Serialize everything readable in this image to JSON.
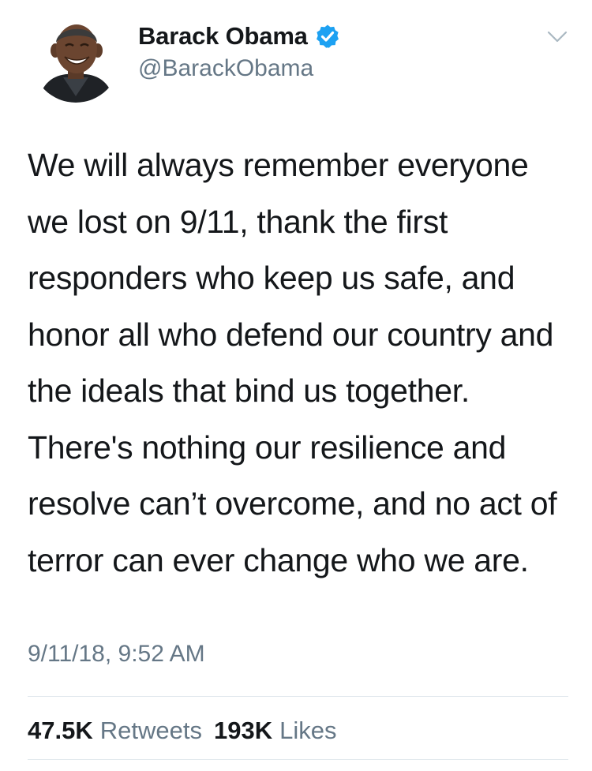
{
  "author": {
    "display_name": "Barack Obama",
    "handle": "@BarackObama",
    "verified": true,
    "verified_badge_color": "#1da1f2"
  },
  "menu": {
    "icon": "chevron-down-icon"
  },
  "tweet": {
    "text": "We will always remember everyone we lost on 9/11, thank the first responders who keep us safe, and honor all who defend our country and the ideals that bind us together. There's nothing our resilience and resolve can’t overcome, and no act of terror can ever change who we are.",
    "timestamp": "9/11/18, 9:52 AM"
  },
  "stats": {
    "retweets_count": "47.5K",
    "retweets_label": "Retweets",
    "likes_count": "193K",
    "likes_label": "Likes"
  },
  "colors": {
    "text_primary": "#14171a",
    "text_secondary": "#657786",
    "divider": "#e1e8ed"
  }
}
